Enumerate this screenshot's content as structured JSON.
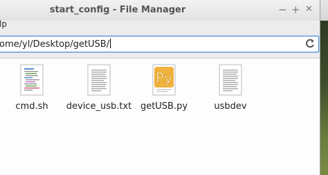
{
  "window": {
    "title": "start_config - File Manager",
    "controls": {
      "minimize": "−",
      "maximize": "+",
      "close": "✕"
    }
  },
  "menubar": {
    "partial_item": "lp"
  },
  "location": {
    "path": "ome/yl/Desktop/getUSB/"
  },
  "files": [
    {
      "name": "cmd.sh",
      "icon": "script-file-icon"
    },
    {
      "name": "device_usb.txt",
      "icon": "text-file-icon"
    },
    {
      "name": "getUSB.py",
      "icon": "python-file-icon"
    },
    {
      "name": "usbdev",
      "icon": "text-file-icon"
    }
  ],
  "colors": {
    "accent": "#4b8bd6",
    "python_badge": "#f0b23c"
  }
}
